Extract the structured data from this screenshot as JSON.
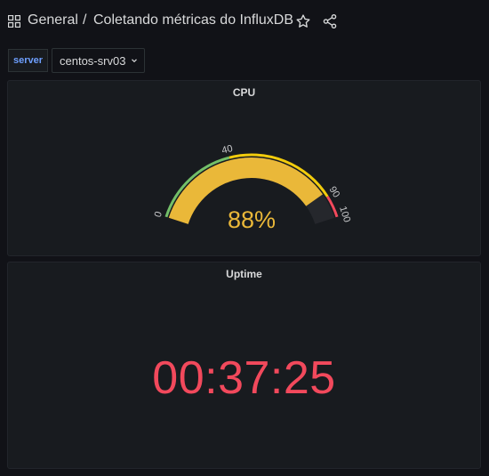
{
  "header": {
    "folder": "General",
    "separator": "/",
    "title": "Coletando métricas do InfluxDB",
    "icons": [
      "apps-icon",
      "star-icon",
      "share-icon"
    ]
  },
  "variables": {
    "label": "server",
    "selected": "centos-srv03"
  },
  "cpu_panel": {
    "title": "CPU",
    "value": 88,
    "value_text": "88%",
    "min": 0,
    "max": 100,
    "thresholds": [
      {
        "from": 0,
        "to": 40,
        "color": "#73bf69"
      },
      {
        "from": 40,
        "to": 90,
        "color": "#f2cc0c"
      },
      {
        "from": 90,
        "to": 100,
        "color": "#f2495c"
      }
    ],
    "tick_labels": [
      "0",
      "40",
      "90",
      "100"
    ],
    "value_color": "#eab839"
  },
  "uptime_panel": {
    "title": "Uptime",
    "value": "00:37:25",
    "value_color": "#f2495c"
  },
  "colors": {
    "background": "#111217",
    "panel": "#181b1f",
    "text": "#d8d9da",
    "accent_blue": "#6e9fff"
  }
}
